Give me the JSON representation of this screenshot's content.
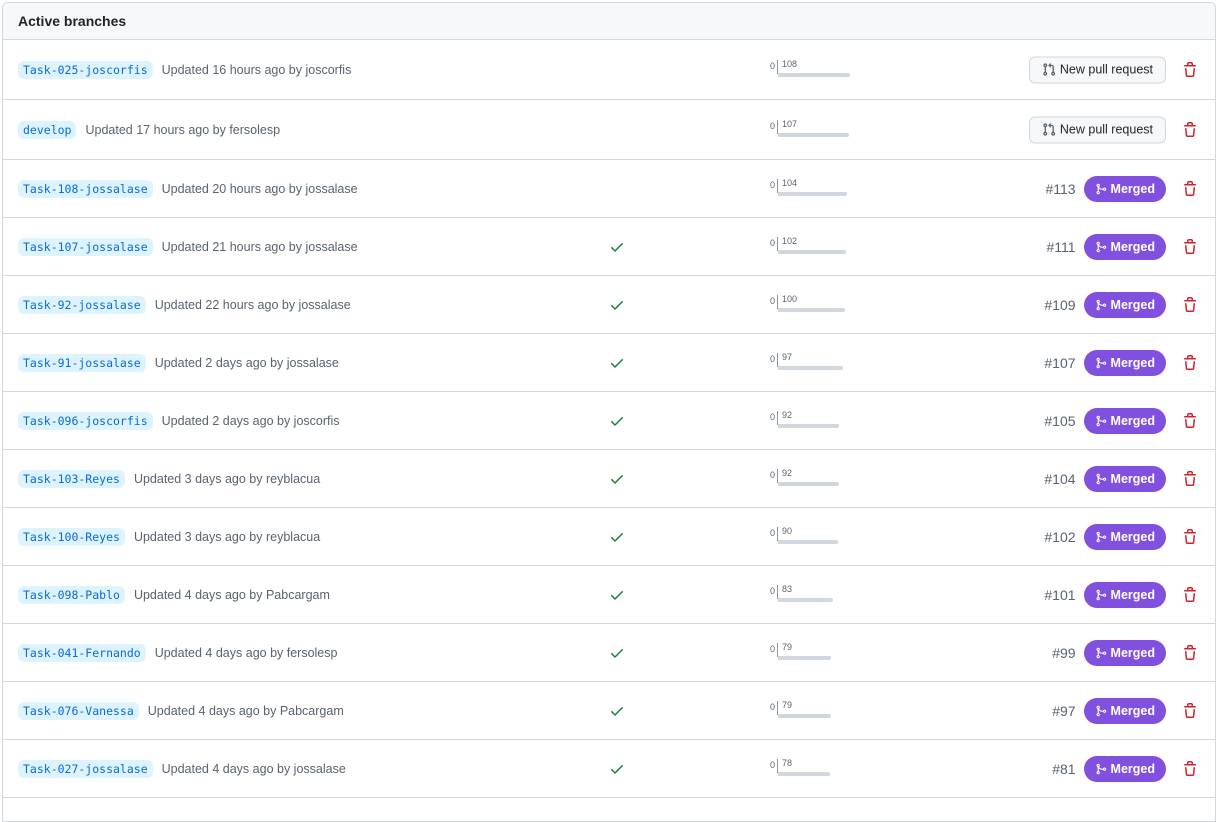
{
  "header": {
    "title": "Active branches"
  },
  "colors": {
    "merged": "#8250df",
    "check": "#1a7f37",
    "delete": "#cf222e",
    "branch_bg": "#ddf4ff",
    "branch_text": "#0969da"
  },
  "icons": {
    "check": "check-icon",
    "delete": "trash-icon",
    "merged": "git-merge-icon",
    "new_pr": "git-pull-request-icon"
  },
  "branches": [
    {
      "name": "Task-025-joscorfis",
      "updated": "Updated 16 hours ago by joscorfis",
      "check": false,
      "behind": "0",
      "ahead": "108",
      "pr": null,
      "status": "New pull request"
    },
    {
      "name": "develop",
      "updated": "Updated 17 hours ago by fersolesp",
      "check": false,
      "behind": "0",
      "ahead": "107",
      "pr": null,
      "status": "New pull request"
    },
    {
      "name": "Task-108-jossalase",
      "updated": "Updated 20 hours ago by jossalase",
      "check": false,
      "behind": "0",
      "ahead": "104",
      "pr": "#113",
      "status": "Merged"
    },
    {
      "name": "Task-107-jossalase",
      "updated": "Updated 21 hours ago by jossalase",
      "check": true,
      "behind": "0",
      "ahead": "102",
      "pr": "#111",
      "status": "Merged"
    },
    {
      "name": "Task-92-jossalase",
      "updated": "Updated 22 hours ago by jossalase",
      "check": true,
      "behind": "0",
      "ahead": "100",
      "pr": "#109",
      "status": "Merged"
    },
    {
      "name": "Task-91-jossalase",
      "updated": "Updated 2 days ago by jossalase",
      "check": true,
      "behind": "0",
      "ahead": "97",
      "pr": "#107",
      "status": "Merged"
    },
    {
      "name": "Task-096-joscorfis",
      "updated": "Updated 2 days ago by joscorfis",
      "check": true,
      "behind": "0",
      "ahead": "92",
      "pr": "#105",
      "status": "Merged"
    },
    {
      "name": "Task-103-Reyes",
      "updated": "Updated 3 days ago by reyblacua",
      "check": true,
      "behind": "0",
      "ahead": "92",
      "pr": "#104",
      "status": "Merged"
    },
    {
      "name": "Task-100-Reyes",
      "updated": "Updated 3 days ago by reyblacua",
      "check": true,
      "behind": "0",
      "ahead": "90",
      "pr": "#102",
      "status": "Merged"
    },
    {
      "name": "Task-098-Pablo",
      "updated": "Updated 4 days ago by Pabcargam",
      "check": true,
      "behind": "0",
      "ahead": "83",
      "pr": "#101",
      "status": "Merged"
    },
    {
      "name": "Task-041-Fernando",
      "updated": "Updated 4 days ago by fersolesp",
      "check": true,
      "behind": "0",
      "ahead": "79",
      "pr": "#99",
      "status": "Merged"
    },
    {
      "name": "Task-076-Vanessa",
      "updated": "Updated 4 days ago by Pabcargam",
      "check": true,
      "behind": "0",
      "ahead": "79",
      "pr": "#97",
      "status": "Merged"
    },
    {
      "name": "Task-027-jossalase",
      "updated": "Updated 4 days ago by jossalase",
      "check": true,
      "behind": "0",
      "ahead": "78",
      "pr": "#81",
      "status": "Merged"
    },
    {
      "name": "",
      "updated": "",
      "check": false,
      "behind": "",
      "ahead": "",
      "pr": null,
      "status": ""
    }
  ]
}
